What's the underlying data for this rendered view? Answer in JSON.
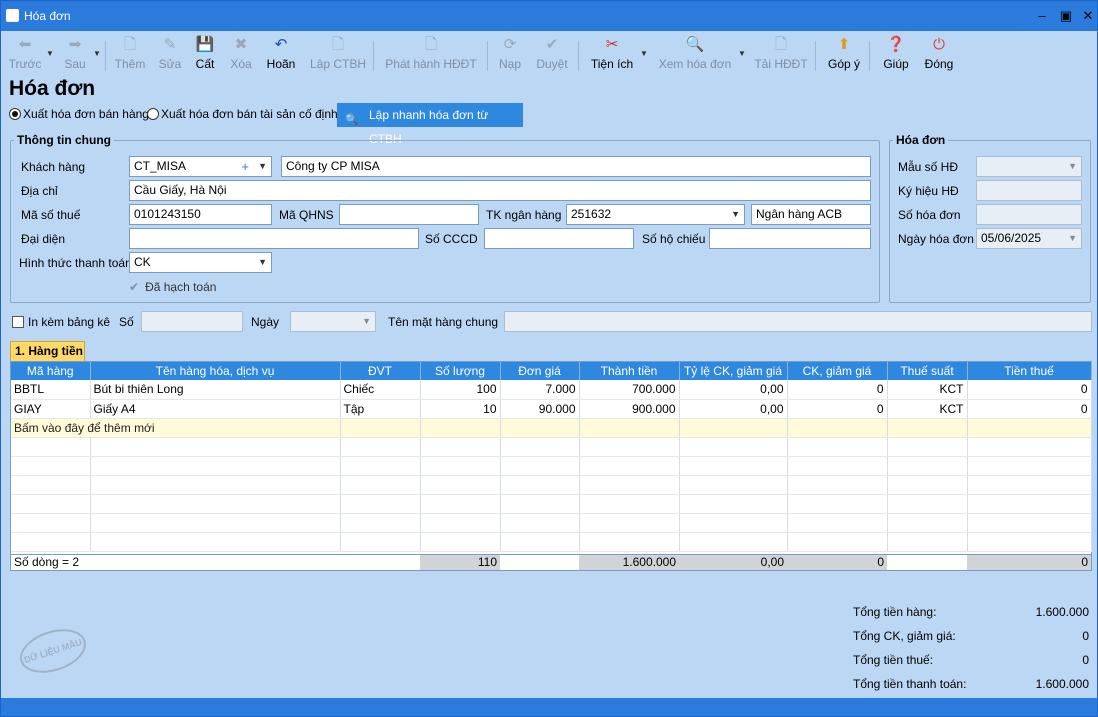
{
  "window": {
    "title": "Hóa đơn"
  },
  "toolbar": {
    "prev": "Trước",
    "next": "Sau",
    "add": "Thêm",
    "edit": "Sửa",
    "save": "Cất",
    "delete": "Xóa",
    "undo": "Hoãn",
    "create_ctbh": "Lập CTBH",
    "issue_einvoice": "Phát hành HĐĐT",
    "load": "Nạp",
    "approve": "Duyệt",
    "utilities": "Tiện ích",
    "view_invoice": "Xem hóa đơn",
    "download_einvoice": "Tải HĐĐT",
    "feedback": "Góp ý",
    "help": "Giúp",
    "close": "Đóng"
  },
  "page": {
    "title": "Hóa đơn"
  },
  "invoice_type": {
    "option_sales": "Xuất hóa đơn bán hàng",
    "option_assets": "Xuất hóa đơn bán tài sản cố định",
    "quick_button": "Lập nhanh hóa đơn từ CTBH"
  },
  "general": {
    "legend": "Thông tin chung",
    "customer_label": "Khách hàng",
    "customer_code": "CT_MISA",
    "customer_name": "Công ty CP MISA",
    "address_label": "Địa chỉ",
    "address": "Cầu Giấy, Hà Nội",
    "tax_code_label": "Mã số thuế",
    "tax_code": "0101243150",
    "qhns_label": "Mã QHNS",
    "qhns": "",
    "bank_account_label": "TK ngân hàng",
    "bank_account": "251632",
    "bank_name": "Ngân hàng ACB",
    "representative_label": "Đại diện",
    "representative": "",
    "cccd_label": "Số CCCD",
    "cccd": "",
    "passport_label": "Số hộ chiếu",
    "passport": "",
    "payment_label": "Hình thức thanh toán",
    "payment": "CK",
    "posted_label": "Đã hạch toán"
  },
  "invoice": {
    "legend": "Hóa đơn",
    "template_label": "Mẫu số HĐ",
    "template": "",
    "symbol_label": "Ký hiệu HĐ",
    "symbol": "",
    "number_label": "Số hóa đơn",
    "number": "",
    "date_label": "Ngày hóa đơn",
    "date": "05/06/2025"
  },
  "attach": {
    "print_list_label": "In kèm bảng kê",
    "no_label": "Số",
    "no": "",
    "date_label": "Ngày",
    "date": "",
    "common_name_label": "Tên mặt hàng chung",
    "common_name": ""
  },
  "tab": {
    "label": "1. Hàng tiền"
  },
  "grid": {
    "columns": [
      "Mã hàng",
      "Tên hàng hóa, dịch vụ",
      "ĐVT",
      "Số lượng",
      "Đơn giá",
      "Thành tiền",
      "Tỷ lệ CK, giảm giá",
      "CK, giảm giá",
      "Thuế suất",
      "Tiền thuế"
    ],
    "rows": [
      {
        "code": "BBTL",
        "name": "Bút bi thiên Long",
        "unit": "Chiếc",
        "qty": "100",
        "price": "7.000",
        "amount": "700.000",
        "disc_rate": "0,00",
        "disc": "0",
        "tax_rate": "KCT",
        "tax": "0"
      },
      {
        "code": "GIAY",
        "name": "Giấy A4",
        "unit": "Tập",
        "qty": "10",
        "price": "90.000",
        "amount": "900.000",
        "disc_rate": "0,00",
        "disc": "0",
        "tax_rate": "KCT",
        "tax": "0"
      }
    ],
    "add_hint": "Bấm vào đây để thêm mới",
    "footer": {
      "row_count": "Số dòng = 2",
      "qty": "110",
      "amount": "1.600.000",
      "disc_rate": "0,00",
      "disc": "0",
      "tax": "0"
    }
  },
  "totals": {
    "goods_label": "Tổng tiền hàng:",
    "goods": "1.600.000",
    "discount_label": "Tổng CK, giảm giá:",
    "discount": "0",
    "tax_label": "Tổng tiền thuế:",
    "tax": "0",
    "payment_label": "Tổng tiền thanh toán:",
    "payment": "1.600.000"
  },
  "stamp": {
    "text": "DỮ LIỆU MẪU"
  }
}
